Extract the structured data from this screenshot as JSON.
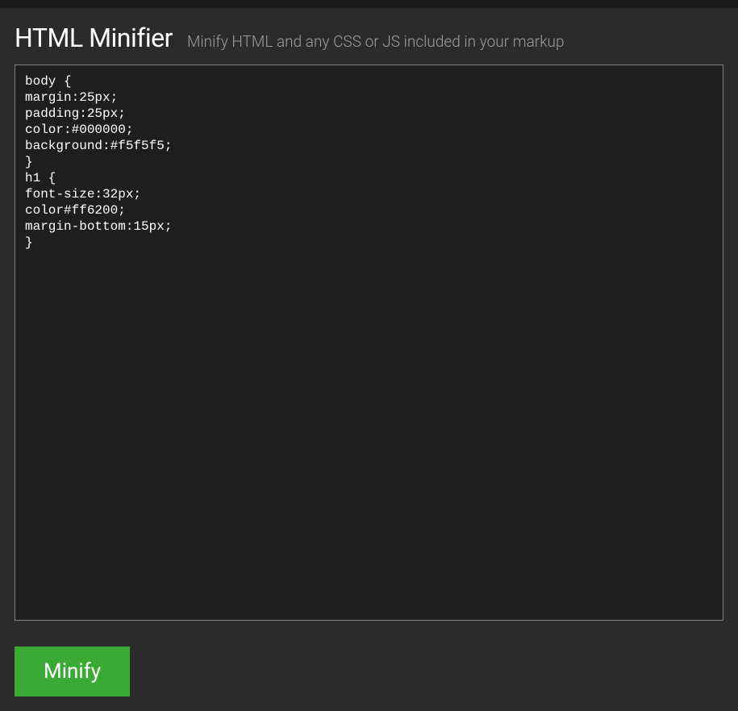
{
  "header": {
    "title": "HTML Minifier",
    "subtitle": "Minify HTML and any CSS or JS included in your markup"
  },
  "editor": {
    "content": "body {\nmargin:25px;\npadding:25px;\ncolor:#000000;\nbackground:#f5f5f5;\n}\nh1 {\nfont-size:32px;\ncolor#ff6200;\nmargin-bottom:15px;\n}"
  },
  "actions": {
    "minify_label": "Minify"
  }
}
